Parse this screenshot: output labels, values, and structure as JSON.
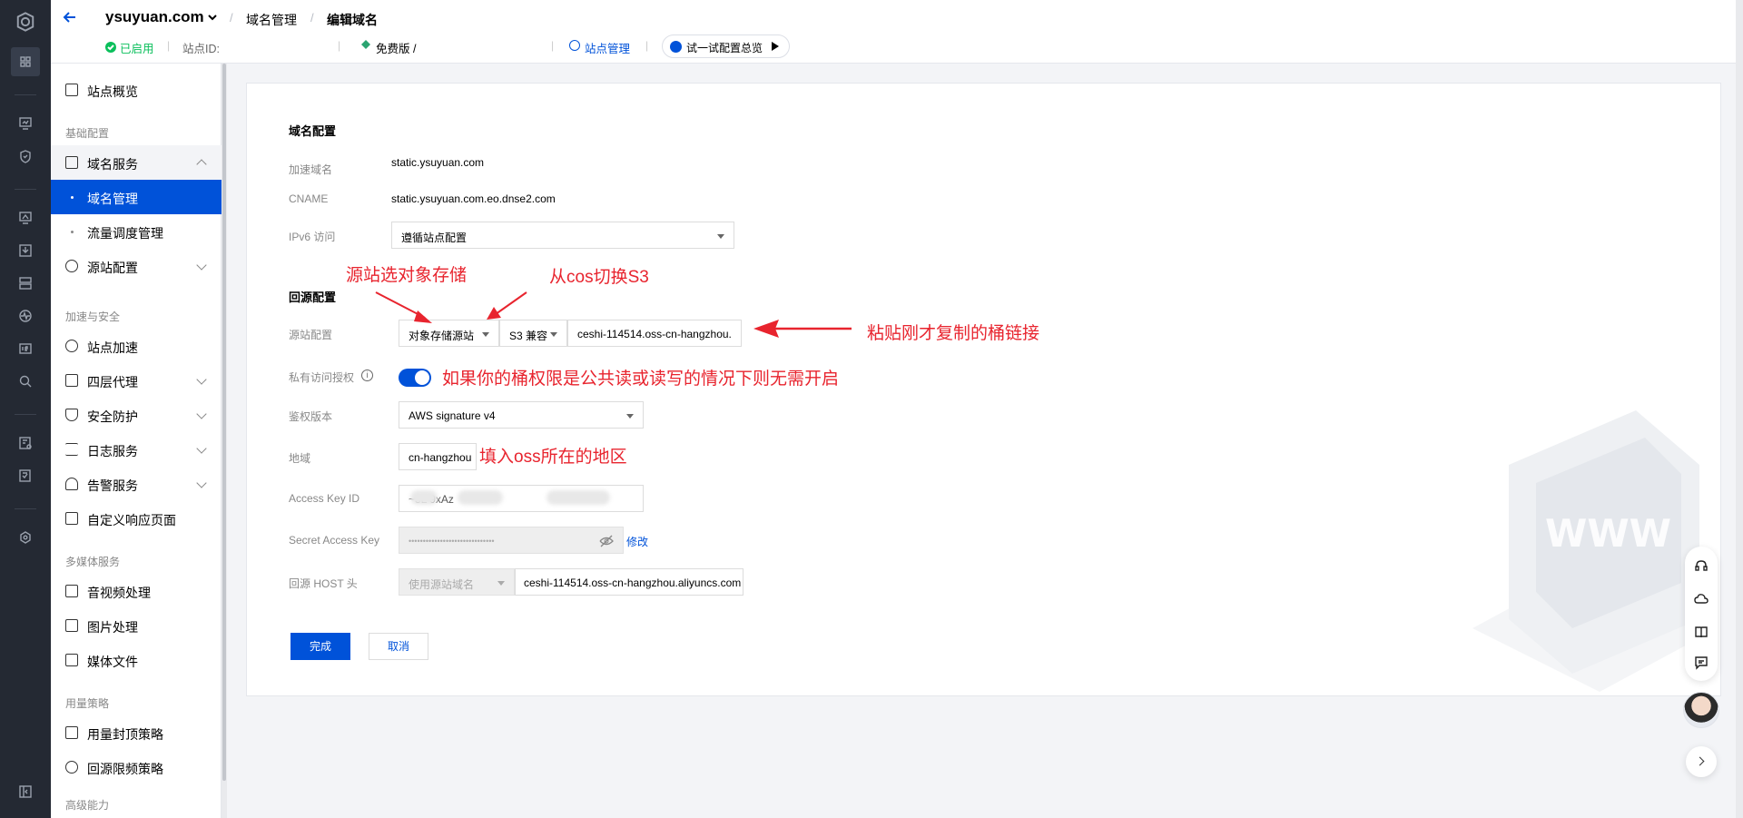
{
  "header": {
    "site": "ysuyuan.com",
    "breadcrumb": [
      "域名管理",
      "编辑域名"
    ],
    "status": "已启用",
    "site_id_label": "站点ID:",
    "plan": "免费版 /",
    "site_manage": "站点管理",
    "try_config": "试一试配置总览"
  },
  "sidebar": {
    "overview": "站点概览",
    "group_basic": "基础配置",
    "domain_service": "域名服务",
    "domain_manage": "域名管理",
    "traffic_manage": "流量调度管理",
    "origin_config": "源站配置",
    "group_accel": "加速与安全",
    "site_accel": "站点加速",
    "l4_proxy": "四层代理",
    "security": "安全防护",
    "log_service": "日志服务",
    "alarm_service": "告警服务",
    "custom_page": "自定义响应页面",
    "group_media": "多媒体服务",
    "av_process": "音视频处理",
    "image_process": "图片处理",
    "media_files": "媒体文件",
    "group_usage": "用量策略",
    "usage_cap": "用量封顶策略",
    "origin_limit": "回源限频策略",
    "group_advanced": "高级能力"
  },
  "form": {
    "section_domain": "域名配置",
    "accel_domain_label": "加速域名",
    "accel_domain": "static.ysuyuan.com",
    "cname_label": "CNAME",
    "cname": "static.ysuyuan.com.eo.dnse2.com",
    "ipv6_label": "IPv6 访问",
    "ipv6_value": "遵循站点配置",
    "section_origin": "回源配置",
    "origin_label": "源站配置",
    "origin_type": "对象存储源站",
    "origin_compat": "S3 兼容",
    "origin_url": "ceshi-114514.oss-cn-hangzhou.",
    "private_auth_label": "私有访问授权",
    "auth_version_label": "鉴权版本",
    "auth_version": "AWS signature v4",
    "region_label": "地域",
    "region": "cn-hangzhou",
    "ak_label": "Access Key ID",
    "ak_value": "~3L 9xAz",
    "sk_label": "Secret Access Key",
    "sk_value": "••••••••••••••••••••••••••••••",
    "sk_modify": "修改",
    "host_label": "回源 HOST 头",
    "host_mode": "使用源站域名",
    "host_value": "ceshi-114514.oss-cn-hangzhou.aliyuncs.com",
    "done": "完成",
    "cancel": "取消"
  },
  "annotations": {
    "a1": "源站选对象存储",
    "a2": "从cos切换S3",
    "a3": "粘贴刚才复制的桶链接",
    "a4": "如果你的桶权限是公共读或读写的情况下则无需开启",
    "a5": "填入oss所在的地区"
  },
  "colors": {
    "primary": "#0052d9",
    "annotation": "#e8242e",
    "rail": "#242933"
  }
}
